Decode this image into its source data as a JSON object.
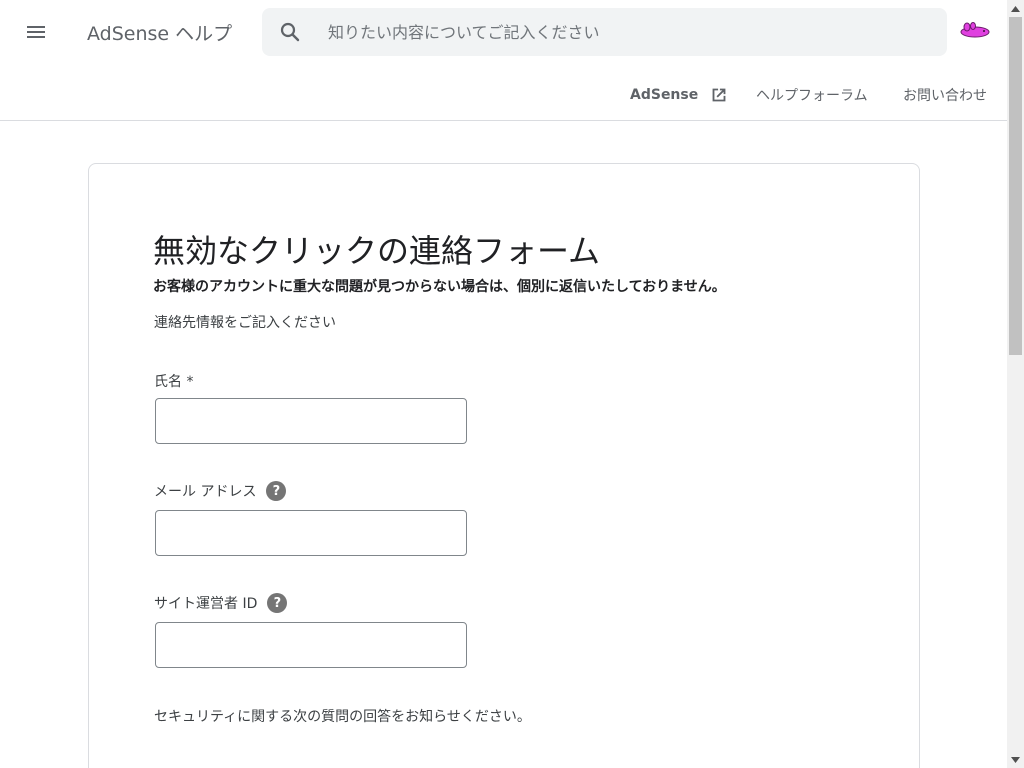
{
  "header": {
    "title": "AdSense ヘルプ",
    "search_placeholder": "知りたい内容についてご記入ください",
    "icons": {
      "menu": "menu-icon",
      "search": "search-icon",
      "avatar": "account-avatar"
    }
  },
  "subnav": {
    "adsense_label": "AdSense",
    "forum_label": "ヘルプフォーラム",
    "contact_label": "お問い合わせ"
  },
  "form": {
    "title": "無効なクリックの連絡フォーム",
    "notice": "お客様のアカウントに重大な問題が見つからない場合は、個別に返信いたしておりません。",
    "intro": "連絡先情報をご記入ください",
    "fields": [
      {
        "label": "氏名 *",
        "value": "",
        "help": false
      },
      {
        "label": "メール アドレス",
        "value": "",
        "help": true
      },
      {
        "label": "サイト運営者 ID",
        "value": "",
        "help": true
      }
    ],
    "help_glyph": "?",
    "security_text": "セキュリティに関する次の質問の回答をお知らせください。"
  },
  "colors": {
    "accent_text": "#5f6368",
    "border": "#dadce0",
    "search_bg": "#f1f3f4",
    "avatar": "#e040e0"
  }
}
